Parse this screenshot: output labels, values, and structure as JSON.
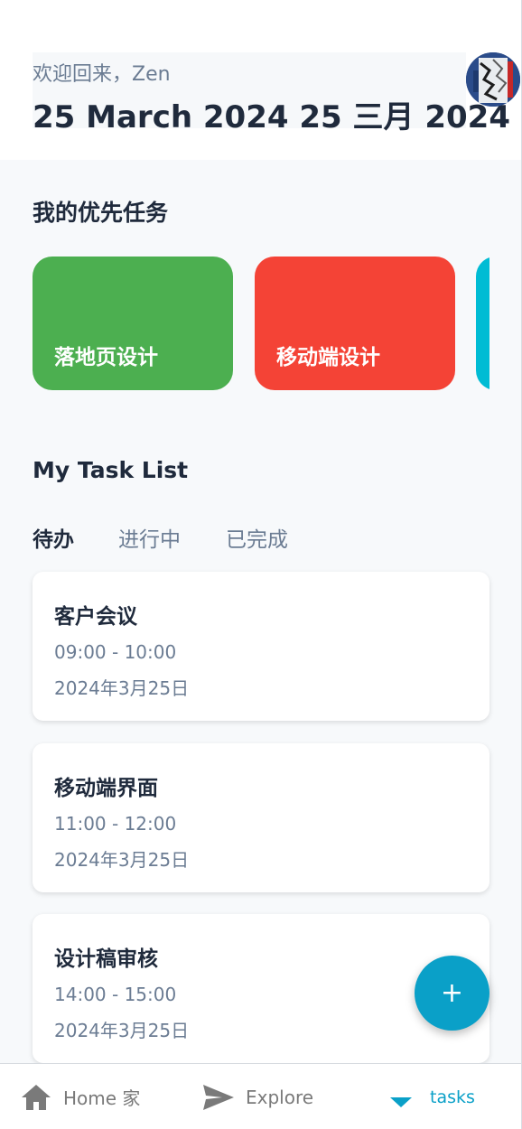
{
  "header": {
    "greeting": "欢迎回来，Zen",
    "date_title": "25 March 2024  25 三月 2024"
  },
  "priority": {
    "title": "我的优先任务",
    "cards": [
      {
        "label": "落地页设计",
        "color": "#4caf50"
      },
      {
        "label": "移动端设计",
        "color": "#f44336"
      },
      {
        "label": "",
        "color": "#00bcd4"
      }
    ]
  },
  "task_list": {
    "title": "My Task List",
    "tabs": [
      {
        "label": "待办",
        "active": true
      },
      {
        "label": "进行中",
        "active": false
      },
      {
        "label": "已完成",
        "active": false
      }
    ],
    "tasks": [
      {
        "title": "客户会议",
        "time": "09:00 - 10:00",
        "date": "2024年3月25日"
      },
      {
        "title": "移动端界面",
        "time": "11:00 - 12:00",
        "date": "2024年3月25日"
      },
      {
        "title": "设计稿审核",
        "time": "14:00 - 15:00",
        "date": "2024年3月25日"
      }
    ]
  },
  "fab": {
    "symbol": "+",
    "color": "#0aa0c8"
  },
  "bottom_nav": {
    "items": [
      {
        "label": "Home  家",
        "icon": "home-icon"
      },
      {
        "label": "Explore",
        "icon": "send-icon"
      },
      {
        "label": "tasks",
        "icon": "caret-down-icon",
        "active": true
      }
    ]
  }
}
